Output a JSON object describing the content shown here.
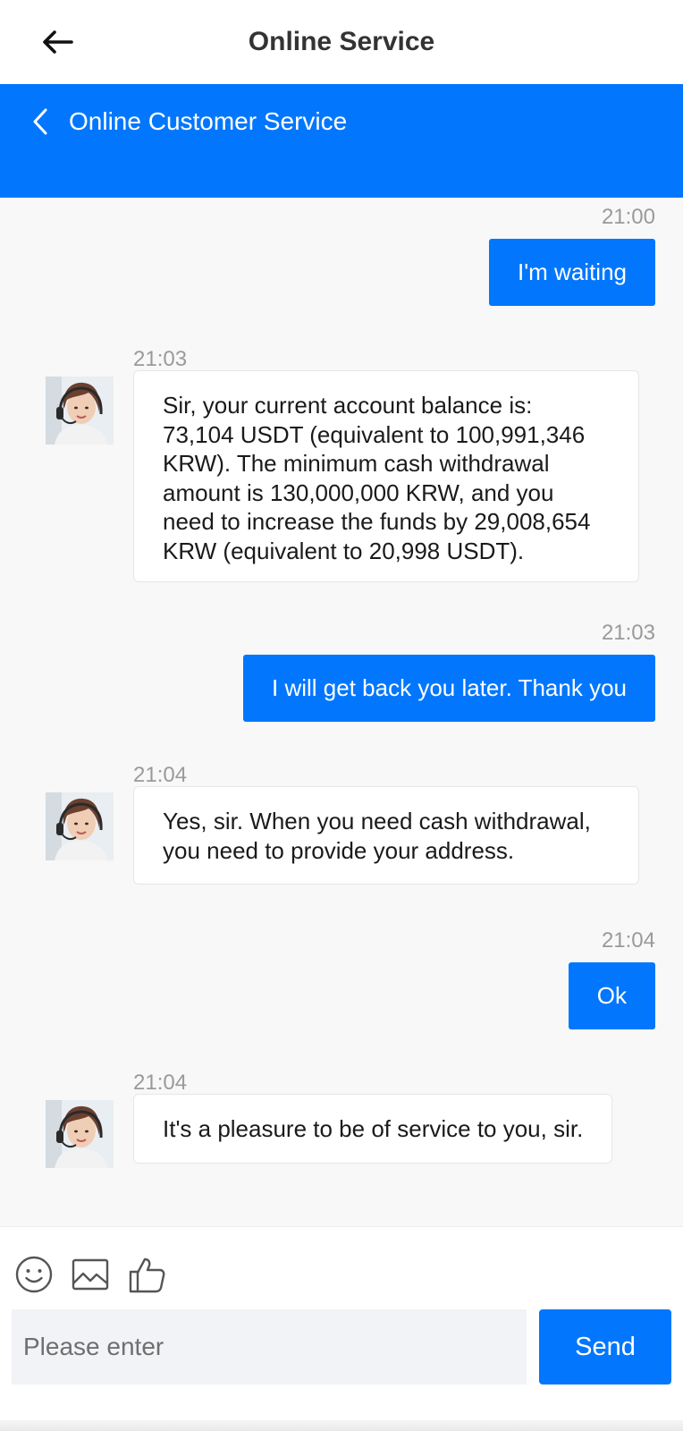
{
  "topbar": {
    "title": "Online Service",
    "back_icon": "arrow-left-icon"
  },
  "header": {
    "title": "Online Customer Service",
    "back_icon": "chevron-left-icon",
    "color": "#0277fd"
  },
  "messages": [
    {
      "time": "21:00",
      "side": "out",
      "text": "I'm waiting"
    },
    {
      "time": "21:03",
      "side": "in",
      "text": "Sir, your current account balance is: 73,104 USDT (equivalent to 100,991,346 KRW). The minimum cash withdrawal amount is 130,000,000 KRW, and you need to increase the funds by 29,008,654 KRW (equivalent to 20,998 USDT)."
    },
    {
      "time": "21:03",
      "side": "out",
      "text": "I will get back you later. Thank you"
    },
    {
      "time": "21:04",
      "side": "in",
      "text": "Yes, sir. When you need cash withdrawal, you need to provide your address."
    },
    {
      "time": "21:04",
      "side": "out",
      "text": "Ok"
    },
    {
      "time": "21:04",
      "side": "in",
      "text": "It's a pleasure to be of service to you, sir."
    }
  ],
  "toolbar": {
    "icons": [
      "smiley-icon",
      "image-icon",
      "thumbs-up-icon"
    ]
  },
  "composer": {
    "placeholder": "Please enter",
    "value": "",
    "send_label": "Send"
  },
  "colors": {
    "accent": "#0277fd",
    "background": "#f8f8f8",
    "timestamp": "#9a9a9a"
  }
}
